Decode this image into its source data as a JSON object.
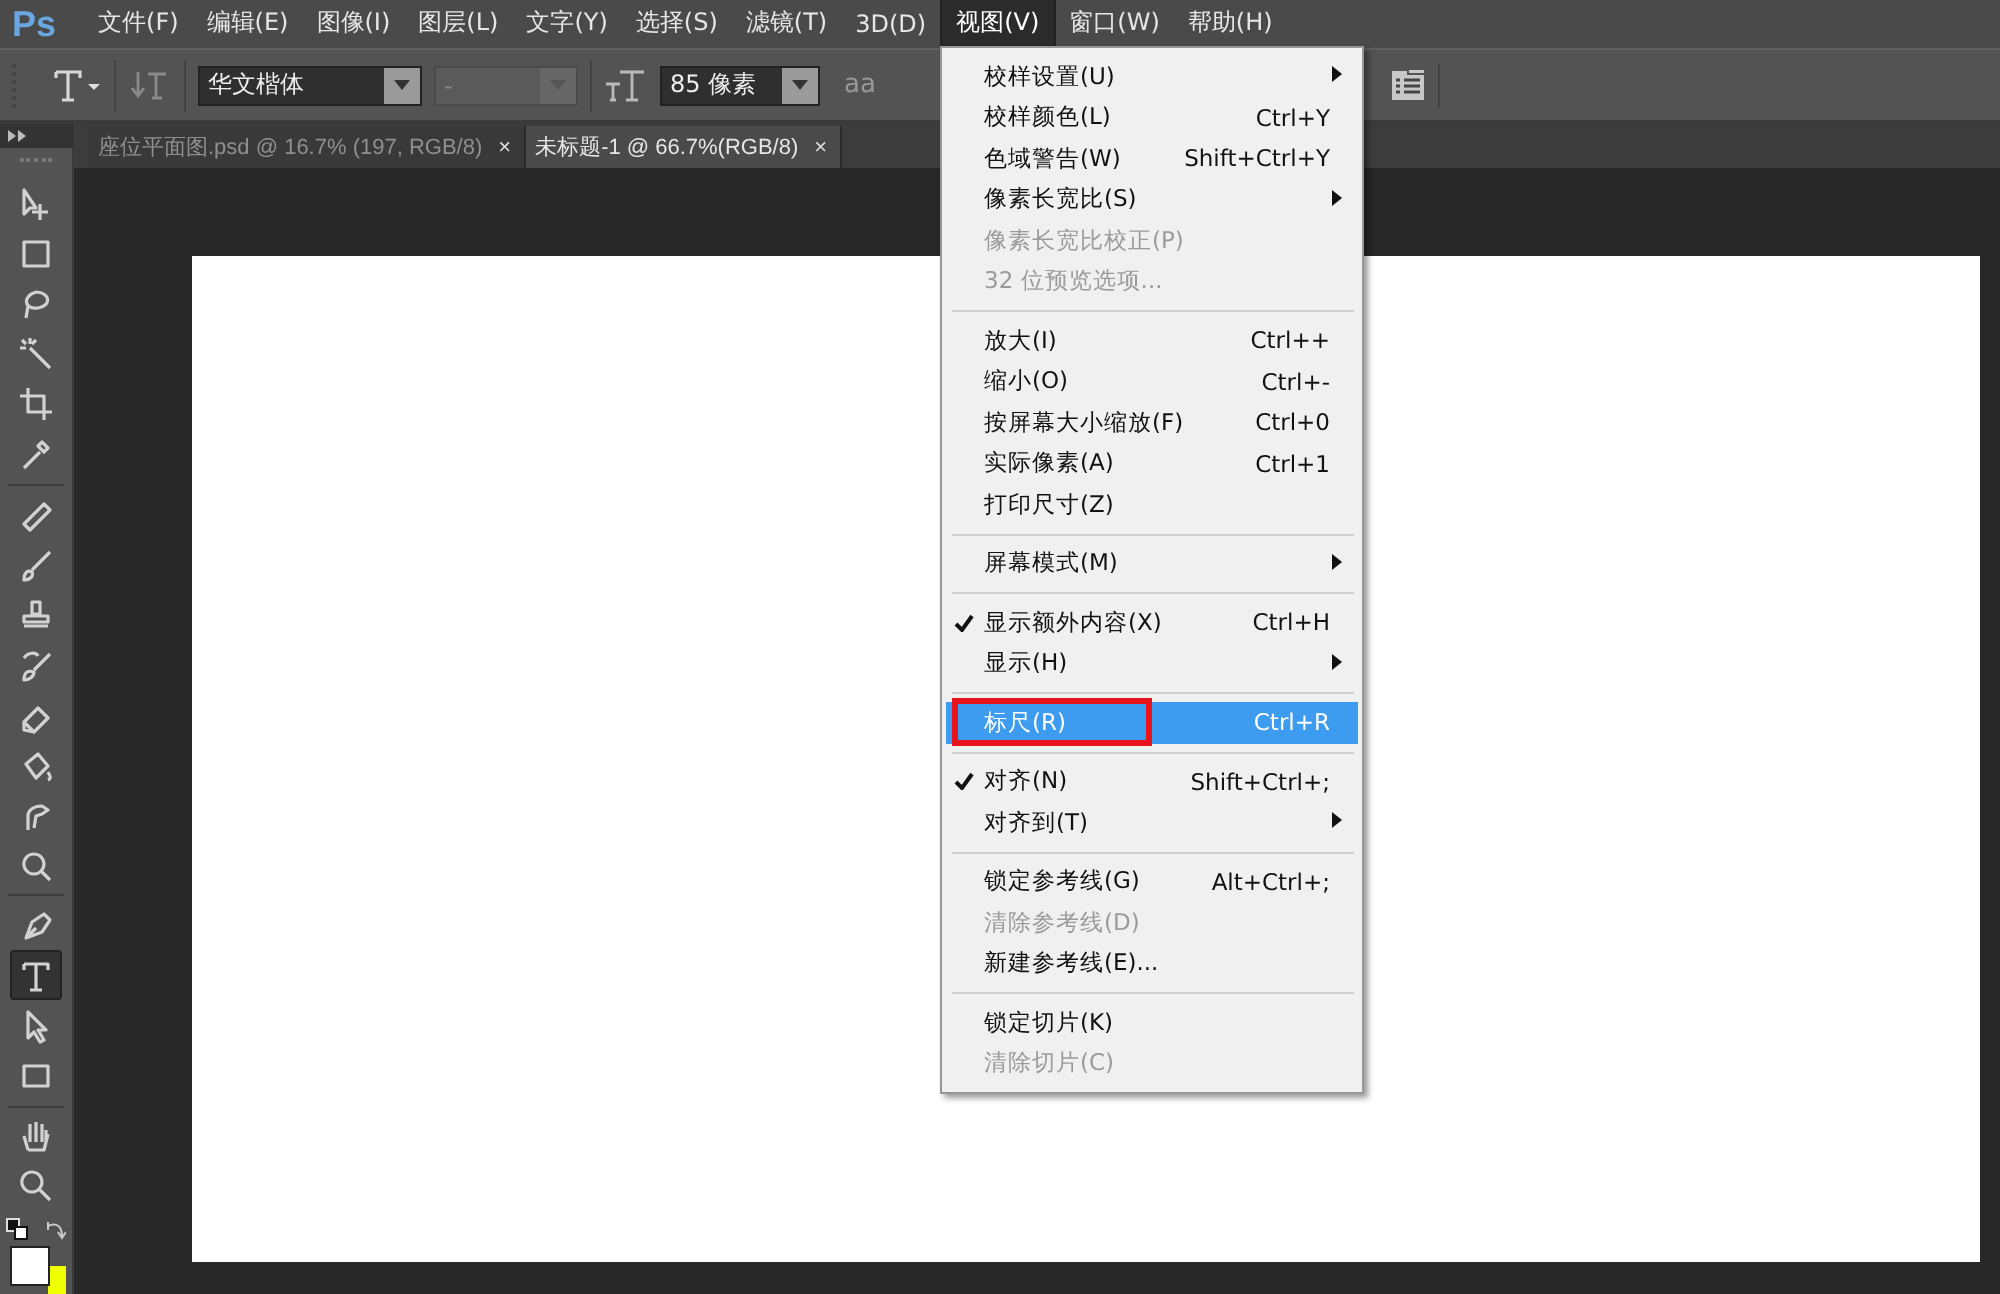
{
  "app_logo": "Ps",
  "menubar": [
    {
      "label": "文件(F)",
      "selected": false
    },
    {
      "label": "编辑(E)",
      "selected": false
    },
    {
      "label": "图像(I)",
      "selected": false
    },
    {
      "label": "图层(L)",
      "selected": false
    },
    {
      "label": "文字(Y)",
      "selected": false
    },
    {
      "label": "选择(S)",
      "selected": false
    },
    {
      "label": "滤镜(T)",
      "selected": false
    },
    {
      "label": "3D(D)",
      "selected": false
    },
    {
      "label": "视图(V)",
      "selected": true
    },
    {
      "label": "窗口(W)",
      "selected": false
    },
    {
      "label": "帮助(H)",
      "selected": false
    }
  ],
  "options_bar": {
    "font_family": "华文楷体",
    "font_style": {
      "value": "-",
      "disabled": true
    },
    "font_size": "85 像素",
    "anti_alias": "aa"
  },
  "document_tabs": [
    {
      "title": "座位平面图.psd @ 16.7% (197, RGB/8)",
      "close": "×",
      "selected": false
    },
    {
      "title": "未标题-1 @ 66.7%(RGB/8)",
      "close": "×",
      "selected": true
    }
  ],
  "tool_groups": [
    [
      {
        "kind": "move",
        "selected": false
      },
      {
        "kind": "marquee",
        "selected": false
      },
      {
        "kind": "lasso",
        "selected": false
      },
      {
        "kind": "wand",
        "selected": false
      },
      {
        "kind": "crop",
        "selected": false
      },
      {
        "kind": "eyedropper",
        "selected": false
      }
    ],
    [
      {
        "kind": "bandage",
        "selected": false
      },
      {
        "kind": "brush",
        "selected": false
      },
      {
        "kind": "stamp",
        "selected": false
      },
      {
        "kind": "history",
        "selected": false
      },
      {
        "kind": "eraser",
        "selected": false
      },
      {
        "kind": "bucket",
        "selected": false
      },
      {
        "kind": "smudge",
        "selected": false
      },
      {
        "kind": "dodge",
        "selected": false
      }
    ],
    [
      {
        "kind": "pen",
        "selected": false
      },
      {
        "kind": "type",
        "selected": true
      },
      {
        "kind": "select",
        "selected": false
      },
      {
        "kind": "rect",
        "selected": false
      }
    ],
    [
      {
        "kind": "hand",
        "selected": false
      },
      {
        "kind": "zoom",
        "selected": false
      }
    ]
  ],
  "view_menu": {
    "groups": [
      [
        {
          "label": "校样设置(U)",
          "submenu": true,
          "disabled": false,
          "checked": false,
          "selected": false,
          "marked": false
        },
        {
          "label": "校样颜色(L)",
          "shortcut": "Ctrl+Y",
          "submenu": false,
          "disabled": false,
          "checked": false,
          "selected": false,
          "marked": false
        },
        {
          "label": "色域警告(W)",
          "shortcut": "Shift+Ctrl+Y",
          "submenu": false,
          "disabled": false,
          "checked": false,
          "selected": false,
          "marked": false
        },
        {
          "label": "像素长宽比(S)",
          "submenu": true,
          "disabled": false,
          "checked": false,
          "selected": false,
          "marked": false
        },
        {
          "label": "像素长宽比校正(P)",
          "submenu": false,
          "disabled": true,
          "checked": false,
          "selected": false,
          "marked": false
        },
        {
          "label": "32 位预览选项...",
          "submenu": false,
          "disabled": true,
          "checked": false,
          "selected": false,
          "marked": false
        }
      ],
      [
        {
          "label": "放大(I)",
          "shortcut": "Ctrl++",
          "submenu": false,
          "disabled": false,
          "checked": false,
          "selected": false,
          "marked": false
        },
        {
          "label": "缩小(O)",
          "shortcut": "Ctrl+-",
          "submenu": false,
          "disabled": false,
          "checked": false,
          "selected": false,
          "marked": false
        },
        {
          "label": "按屏幕大小缩放(F)",
          "shortcut": "Ctrl+0",
          "submenu": false,
          "disabled": false,
          "checked": false,
          "selected": false,
          "marked": false
        },
        {
          "label": "实际像素(A)",
          "shortcut": "Ctrl+1",
          "submenu": false,
          "disabled": false,
          "checked": false,
          "selected": false,
          "marked": false
        },
        {
          "label": "打印尺寸(Z)",
          "submenu": false,
          "disabled": false,
          "checked": false,
          "selected": false,
          "marked": false
        }
      ],
      [
        {
          "label": "屏幕模式(M)",
          "submenu": true,
          "disabled": false,
          "checked": false,
          "selected": false,
          "marked": false
        }
      ],
      [
        {
          "label": "显示额外内容(X)",
          "shortcut": "Ctrl+H",
          "submenu": false,
          "disabled": false,
          "checked": true,
          "selected": false,
          "marked": false
        },
        {
          "label": "显示(H)",
          "submenu": true,
          "disabled": false,
          "checked": false,
          "selected": false,
          "marked": false
        }
      ],
      [
        {
          "label": "标尺(R)",
          "shortcut": "Ctrl+R",
          "submenu": false,
          "disabled": false,
          "checked": false,
          "selected": true,
          "marked": true
        }
      ],
      [
        {
          "label": "对齐(N)",
          "shortcut": "Shift+Ctrl+;",
          "submenu": false,
          "disabled": false,
          "checked": true,
          "selected": false,
          "marked": false
        },
        {
          "label": "对齐到(T)",
          "submenu": true,
          "disabled": false,
          "checked": false,
          "selected": false,
          "marked": false
        }
      ],
      [
        {
          "label": "锁定参考线(G)",
          "shortcut": "Alt+Ctrl+;",
          "submenu": false,
          "disabled": false,
          "checked": false,
          "selected": false,
          "marked": false
        },
        {
          "label": "清除参考线(D)",
          "submenu": false,
          "disabled": true,
          "checked": false,
          "selected": false,
          "marked": false
        },
        {
          "label": "新建参考线(E)...",
          "submenu": false,
          "disabled": false,
          "checked": false,
          "selected": false,
          "marked": false
        }
      ],
      [
        {
          "label": "锁定切片(K)",
          "submenu": false,
          "disabled": false,
          "checked": false,
          "selected": false,
          "marked": false
        },
        {
          "label": "清除切片(C)",
          "submenu": false,
          "disabled": true,
          "checked": false,
          "selected": false,
          "marked": false
        }
      ]
    ]
  }
}
